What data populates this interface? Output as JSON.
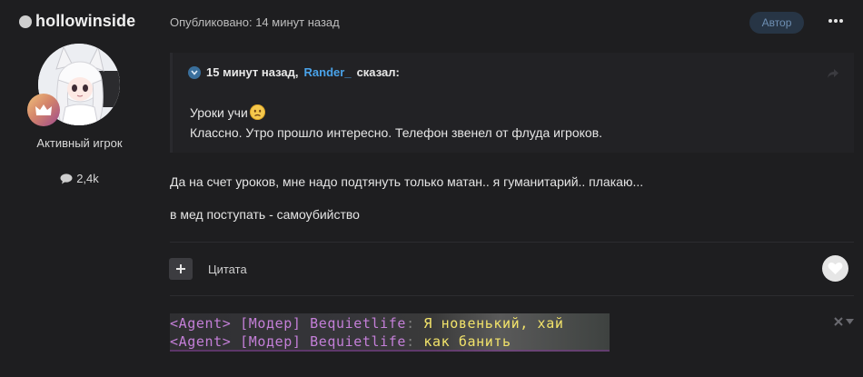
{
  "author": {
    "username": "hollowinside",
    "rank": "Активный игрок",
    "post_count": "2,4k"
  },
  "post": {
    "meta": "Опубликовано: 14 минут назад",
    "author_badge": "Автор",
    "quote": {
      "time": "15 минут назад,",
      "author": "Rander_",
      "said": "сказал:",
      "line1": "Уроки учи",
      "line2": "Классно. Утро прошло интересно. Телефон звенел от флуда игроков."
    },
    "paragraphs": [
      "Да на счет уроков, мне надо подтянуть только матан.. я гуманитарий.. плакаю...",
      "в мед поступать - самоубийство"
    ],
    "quote_button_label": "Цитата"
  },
  "signature": {
    "lines": [
      {
        "tag": "<Agent>",
        "mod": "[Модер]",
        "name": "Bequietlife",
        "sep": ":",
        "msg": "Я новенький, хай"
      },
      {
        "tag": "<Agent>",
        "mod": "[Модер]",
        "name": "Bequietlife",
        "sep": ":",
        "msg": "как банить"
      }
    ]
  },
  "colors": {
    "background": "#1e1e20",
    "accent_link": "#4aa3ea",
    "author_badge_bg": "#273545",
    "author_badge_text": "#6e8fb3"
  },
  "icons": {
    "status": "status-dot-icon",
    "rank": "crown-icon",
    "posts": "comment-bubble-icon",
    "more": "ellipsis-icon",
    "quote_head": "chevron-circle-icon",
    "share": "share-arrow-icon",
    "emoji": "worried-face-emoji-icon",
    "add": "plus-icon",
    "like": "heart-icon",
    "sig_close": "close-icon"
  }
}
